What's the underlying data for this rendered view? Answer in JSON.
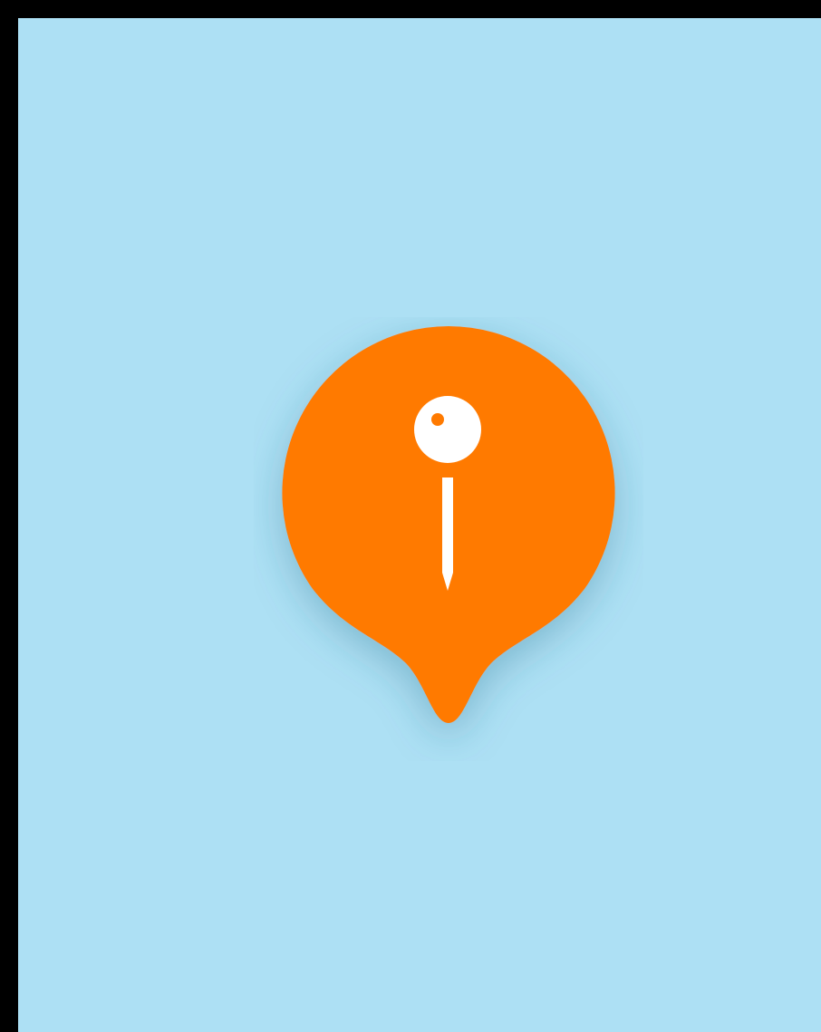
{
  "scene": {
    "frame_color": "#000000",
    "background_color": "#ADE0F4",
    "marker": {
      "icon": "map-marker-icon",
      "fill_color": "#FF7A00",
      "shadow_color": "#2C6E8A",
      "glyph": {
        "icon": "pushpin-icon",
        "color": "#FFFFFF",
        "accent_color": "#FF7A00"
      }
    }
  }
}
